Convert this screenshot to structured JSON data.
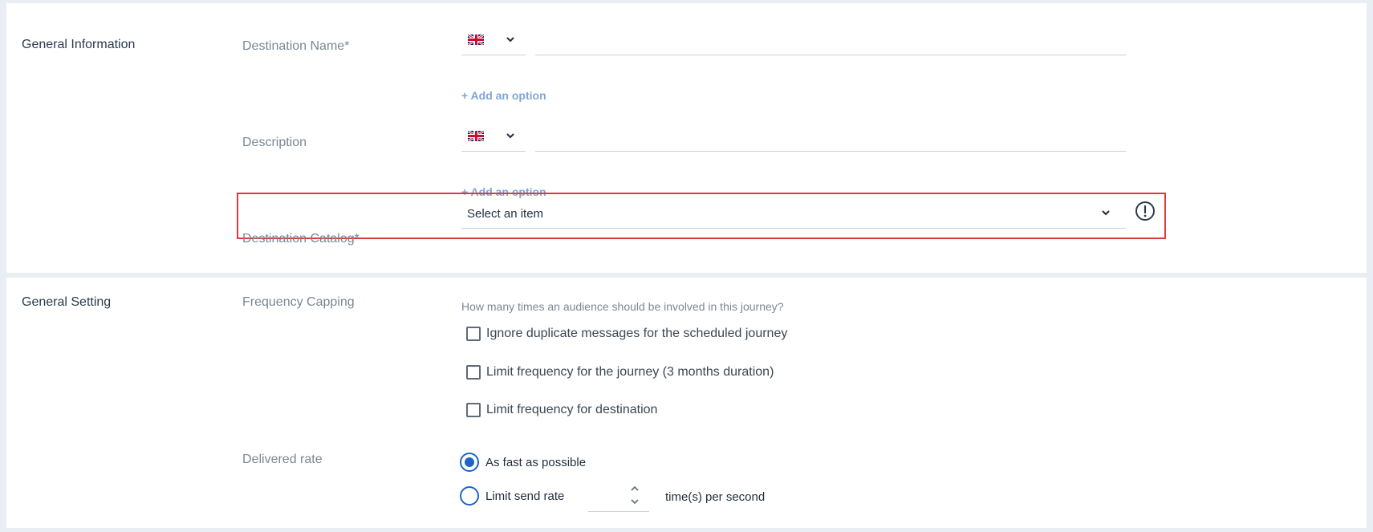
{
  "general_information": {
    "title": "General Information",
    "destination_name": {
      "label": "Destination Name*",
      "language": "English (UK)",
      "value": "",
      "add_option": "+ Add an option"
    },
    "description": {
      "label": "Description",
      "language": "English (UK)",
      "value": "",
      "add_option": "+ Add an option"
    },
    "destination_catalog": {
      "label": "Destination Catalog*",
      "selected": "Select an item"
    }
  },
  "general_setting": {
    "title": "General Setting",
    "frequency_capping": {
      "label": "Frequency Capping",
      "helper": "How many times an audience should be involved in this journey?",
      "options": [
        {
          "label": "Ignore duplicate messages for the scheduled journey",
          "checked": false
        },
        {
          "label": "Limit frequency for the journey (3 months duration)",
          "checked": false
        },
        {
          "label": "Limit frequency for destination",
          "checked": false
        }
      ]
    },
    "delivered_rate": {
      "label": "Delivered rate",
      "options": [
        {
          "label": "As fast as possible",
          "selected": true
        },
        {
          "label": "Limit send rate",
          "selected": false
        }
      ],
      "rate_value": "",
      "unit": "time(s) per second"
    }
  },
  "colors": {
    "accent": "#1f64c8",
    "link": "#7fa7d6",
    "highlight_border": "#e0393e",
    "background": "#e8eef4"
  },
  "icons": {
    "language_flag": "uk-flag-icon",
    "dropdown": "chevron-down-icon",
    "alert": "exclamation-circle-icon",
    "stepper_up": "chevron-up-icon",
    "stepper_down": "chevron-down-icon"
  }
}
